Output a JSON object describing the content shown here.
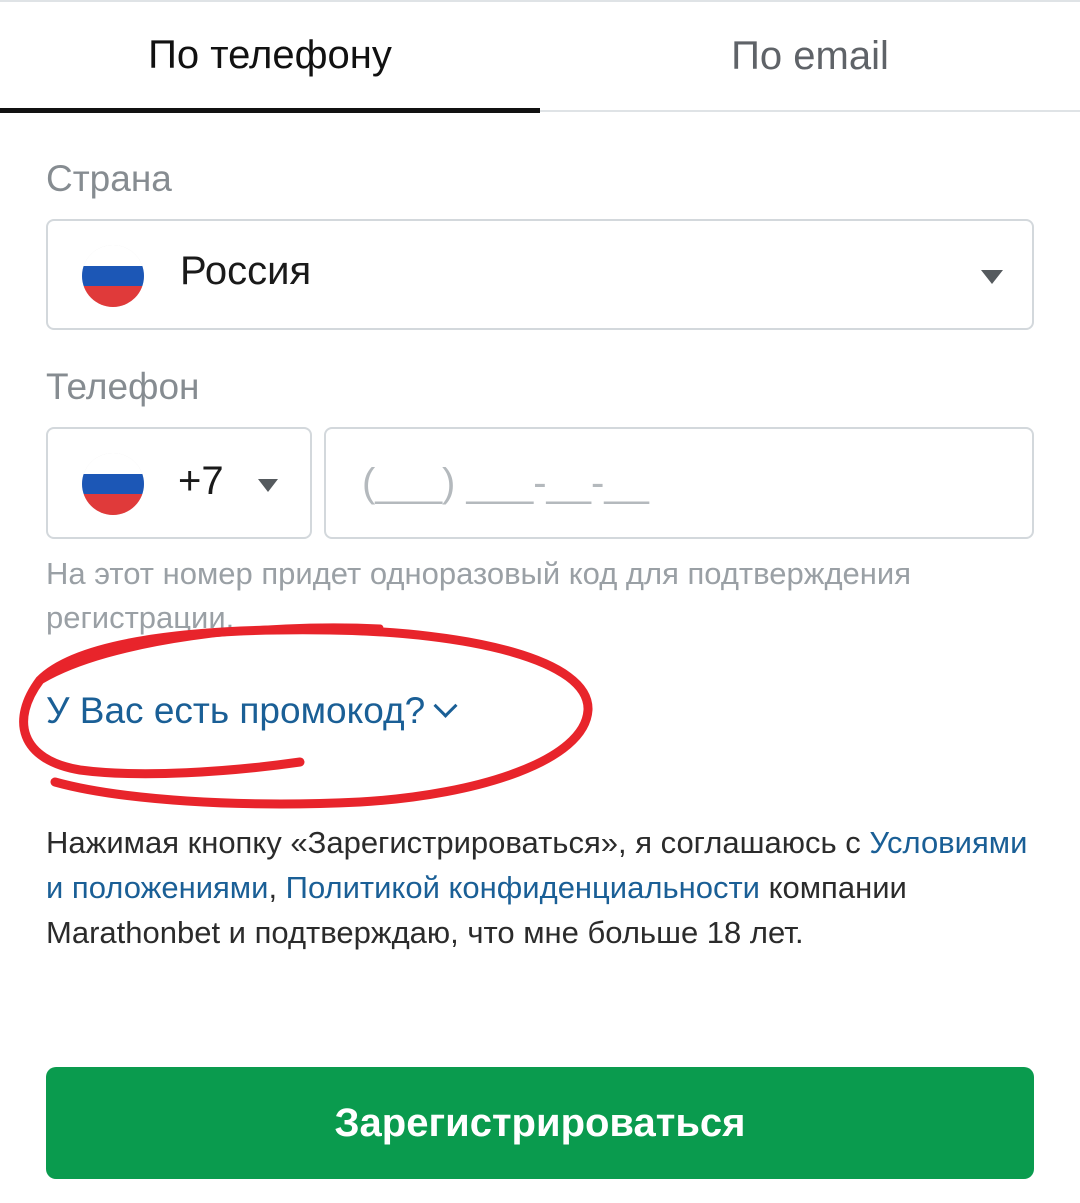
{
  "tabs": [
    {
      "label": "По телефону",
      "active": true
    },
    {
      "label": "По email",
      "active": false
    }
  ],
  "country": {
    "label": "Страна",
    "value": "Россия",
    "flag": "russia-flag-icon"
  },
  "phone": {
    "label": "Телефон",
    "code": "+7",
    "placeholder": "(___) ___-__-__",
    "value": "",
    "hint": "На этот номер придет одноразовый код для подтверждения регистрации."
  },
  "promo": {
    "label": "У Вас есть промокод?"
  },
  "terms": {
    "before": "Нажимая кнопку «Зарегистрироваться», я соглашаюсь с ",
    "link1": "Условиями и положениями",
    "sep": ", ",
    "link2": "Политикой конфиденциальности",
    "after": " компании Marathonbet и подтверждаю, что мне больше 18 лет."
  },
  "register_button": {
    "label": "Зарегистрироваться"
  },
  "colors": {
    "accent_green": "#0a9b4e",
    "link_blue": "#1a5f96",
    "annotation_red": "#e8242b"
  }
}
